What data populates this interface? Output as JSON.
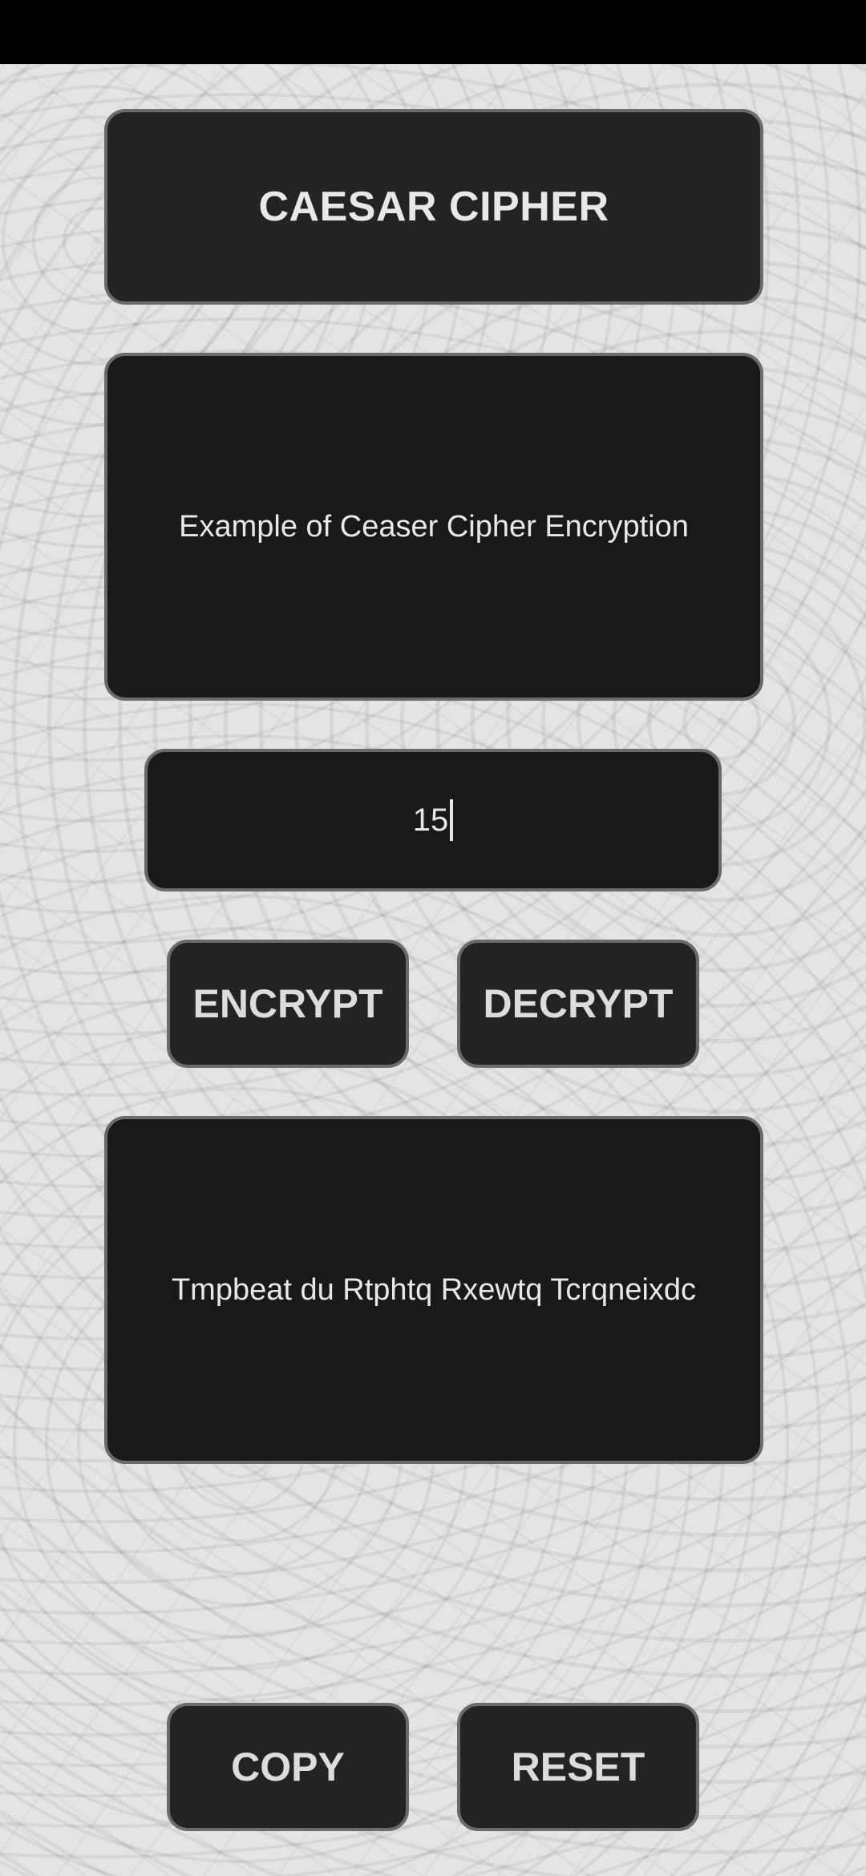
{
  "app": {
    "title": "CAESAR CIPHER"
  },
  "input": {
    "text": "Example of Ceaser Cipher Encryption"
  },
  "shift": {
    "value": "15"
  },
  "actions": {
    "encrypt_label": "ENCRYPT",
    "decrypt_label": "DECRYPT",
    "copy_label": "COPY",
    "reset_label": "RESET"
  },
  "output": {
    "text": "Tmpbeat du Rtphtq Rxewtq Tcrqneixdc"
  },
  "colors": {
    "card_background": "#232323",
    "field_background": "#191919",
    "border": "#6b6b6b",
    "text": "#e8e8e8",
    "status_bar": "#000000"
  }
}
